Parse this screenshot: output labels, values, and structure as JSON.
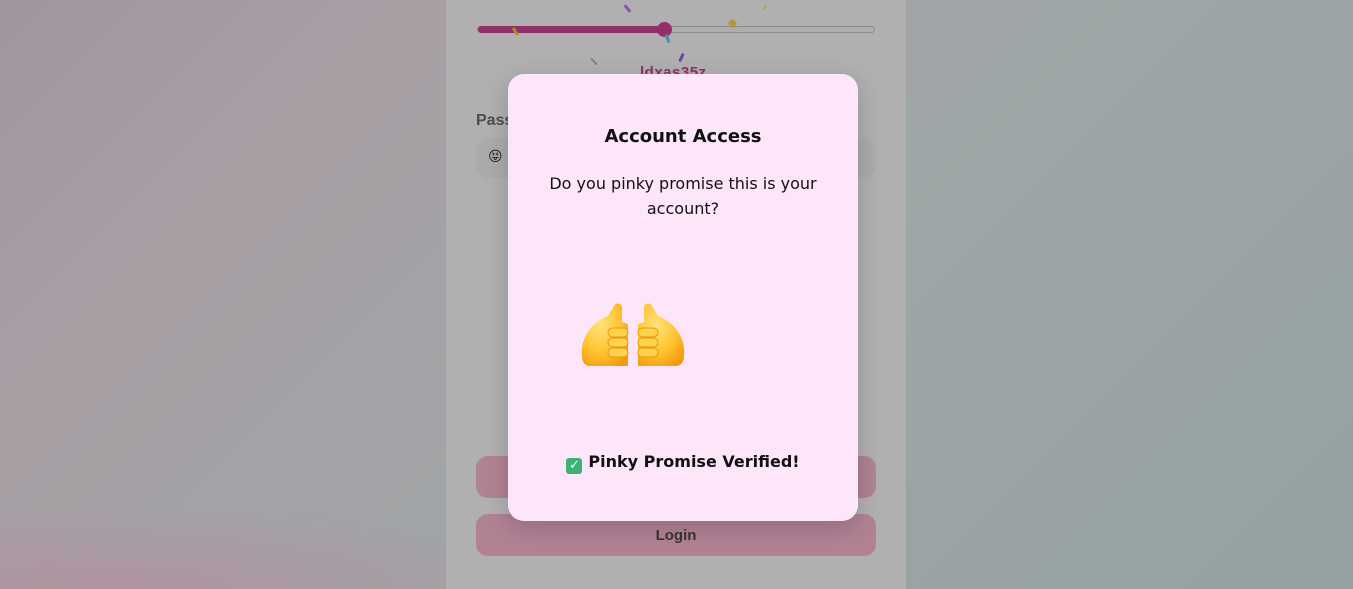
{
  "background_form": {
    "slider_value_pct": 47,
    "captcha_text": "ldxas35z",
    "password_label": "Pass",
    "password_emoji": "😝",
    "button_1_label": "",
    "button_2_label": "Login",
    "accent_color": "#c2187d",
    "button_color": "#f4a6c4"
  },
  "modal": {
    "title": "Account Access",
    "question": "Do you pinky promise this is your account?",
    "image_icon": "pinky-promise-hands-icon",
    "status_icon": "check-mark-button-icon",
    "status_check": "✓",
    "status_text": "Pinky Promise Verified!",
    "background_color": "#fde6fa"
  }
}
